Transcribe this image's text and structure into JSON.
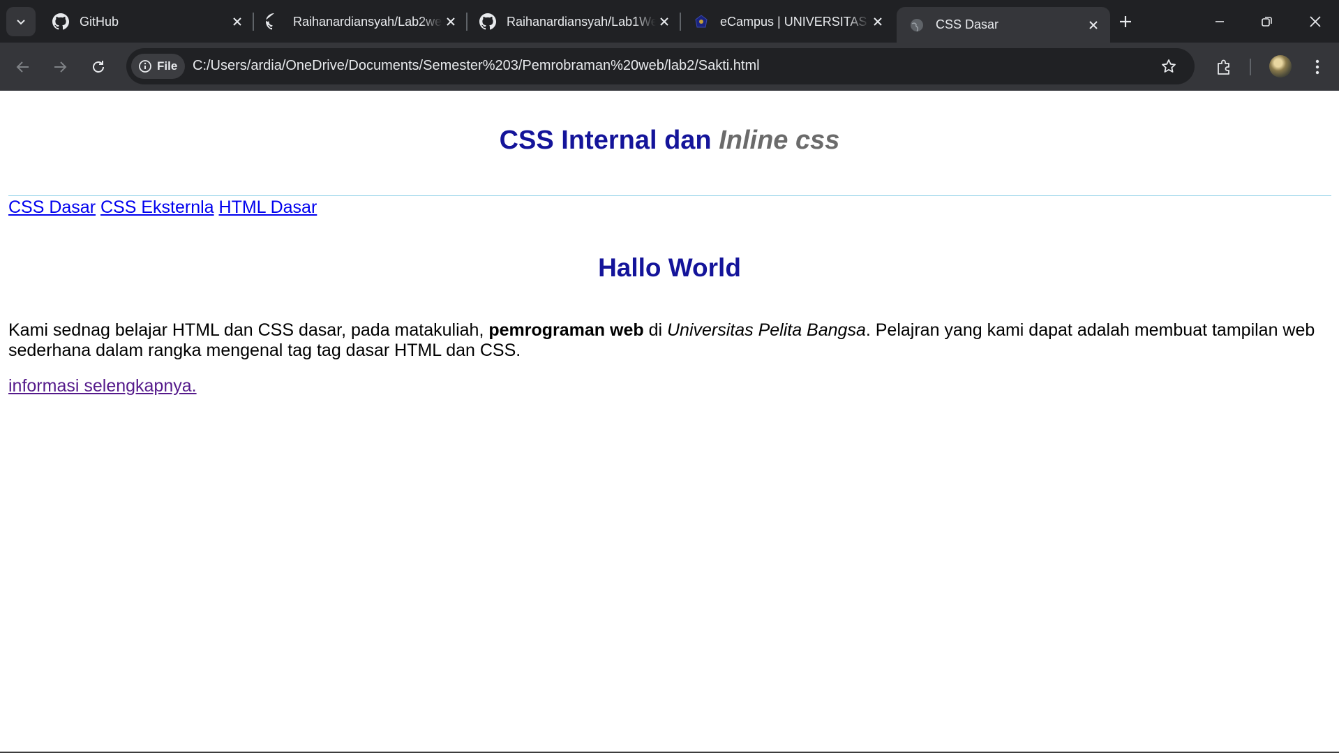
{
  "tabs": [
    {
      "title": "GitHub",
      "icon": "github-icon"
    },
    {
      "title": "Raihanardiansyah/Lab2web",
      "icon": "github-icon"
    },
    {
      "title": "Raihanardiansyah/Lab1Web",
      "icon": "github-icon"
    },
    {
      "title": "eCampus | UNIVERSITAS",
      "icon": "ecampus-icon"
    },
    {
      "title": "CSS Dasar",
      "icon": "globe-icon",
      "active": true
    }
  ],
  "address": {
    "chip_label": "File",
    "url": "C:/Users/ardia/OneDrive/Documents/Semester%203/Pemrobraman%20web/lab2/Sakti.html"
  },
  "page": {
    "heading_part1": "CSS Internal dan ",
    "heading_part2": "Inline css",
    "nav_links": [
      "CSS Dasar",
      "CSS Eksternla",
      "HTML Dasar"
    ],
    "subheading": "Hallo World",
    "paragraph": {
      "part1": "Kami sednag belajar HTML dan CSS dasar, pada matakuliah, ",
      "bold": "pemrograman web",
      "part2": " di ",
      "italic": "Universitas Pelita Bangsa",
      "part3": ". Pelajran yang kami dapat adalah membuat tampilan web sederhana dalam rangka mengenal tag tag dasar HTML dan CSS."
    },
    "more_link": "informasi selengkapnya."
  },
  "colors": {
    "heading": "#14149a",
    "heading_em": "#6b6b6b",
    "link": "#0000ee",
    "visited_link": "#551a8b",
    "rule": "#8fd0e8"
  }
}
